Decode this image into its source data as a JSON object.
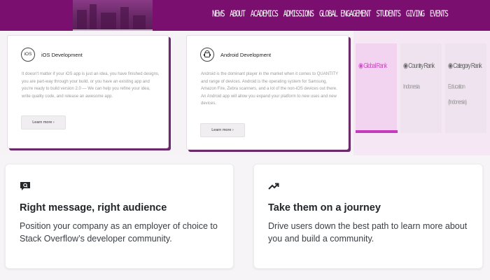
{
  "nav": [
    "NEWS",
    "ABOUT",
    "ACADEMICS",
    "ADMISSIONS",
    "GLOBAL ENGAGEMENT",
    "STUDENTS",
    "GIVING",
    "EVENTS"
  ],
  "services": [
    {
      "icon": "ios-icon",
      "icon_text": "iOS",
      "title": "iOS Development",
      "body": "It doesn't matter if your iOS app is just an idea, you have finished designs, you are part-way through your build, or you have an existing app and you're ready to build version 2.0 — We can help you refine your idea, write quality code, and release an awesome app.",
      "button": "Learn more ›"
    },
    {
      "icon": "android-icon",
      "title": "Android Development",
      "body": "Android is the dominant player in the market when it comes to QUANTITY and range of devices. Android is the operating system for Samsung, Amazon Fire, Zebra scanners, and a lot of the non-iOS devices out there. An Android app will allow you expand your platform to new uses and new devices.",
      "button": "Learn more ›"
    }
  ],
  "ranks": [
    {
      "label": "◉ Global Rank",
      "values": []
    },
    {
      "label": "◉ Country Rank",
      "values": [
        "Indonesia"
      ]
    },
    {
      "label": "◉ Category Rank",
      "values": [
        "Education",
        "(Indonesia)"
      ]
    }
  ],
  "features": [
    {
      "icon": "speech-bubble-icon",
      "title": "Right message, right audience",
      "body": "Position your company as an employer of choice to Stack Overflow’s developer community."
    },
    {
      "icon": "trending-up-icon",
      "title": "Take them on a journey",
      "body": "Drive users down the best path to learn more about you and build a community."
    }
  ],
  "colors": {
    "brand": "#7a0f70",
    "accent": "#c53bc0"
  }
}
